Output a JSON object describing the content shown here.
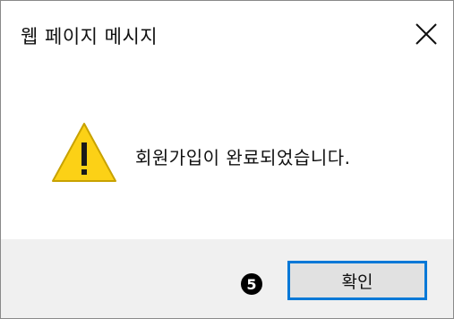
{
  "dialog": {
    "title": "웹 페이지 메시지",
    "close_icon": "close-icon",
    "message": "회원가입이 완료되었습니다.",
    "warning_icon": "warning-icon",
    "ok_label": "확인",
    "step_number": "5"
  },
  "colors": {
    "warning_fill": "#fcd116",
    "warning_stroke": "#c8a200",
    "button_border": "#0078d7",
    "button_bg": "#e1e1e1",
    "footer_bg": "#f0f0f0"
  }
}
